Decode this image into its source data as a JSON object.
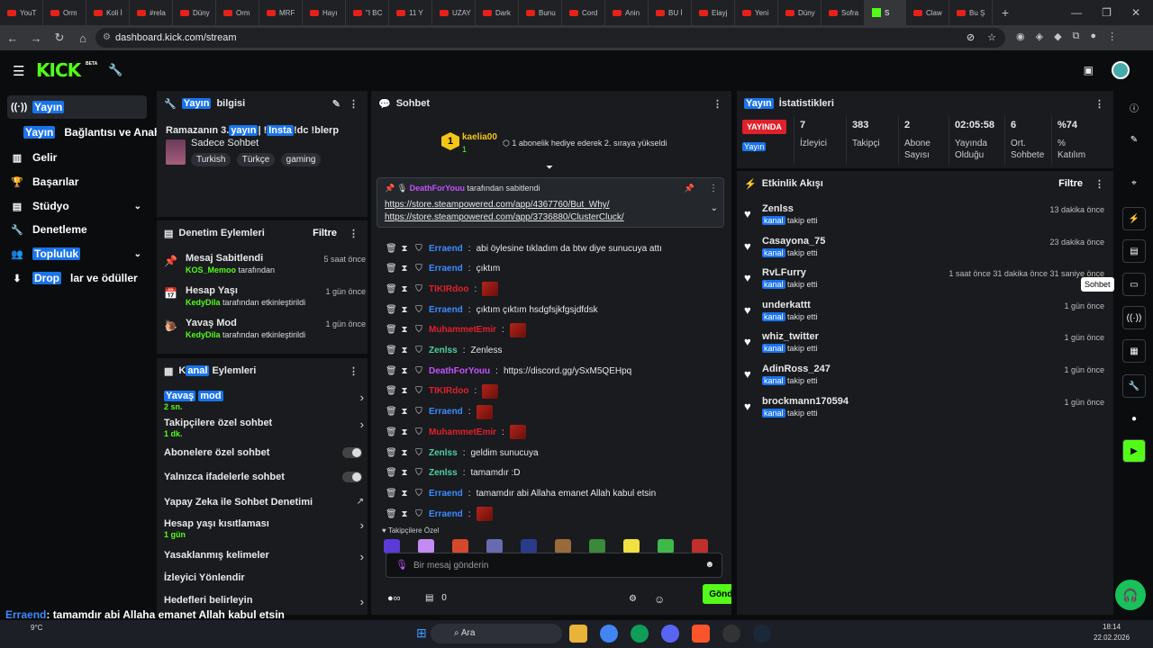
{
  "browser": {
    "tabs": [
      "YouT",
      "Orm",
      "Koli İ",
      "#rela",
      "Düny",
      "Orm",
      "MRF",
      "Hayı",
      "\"I BC",
      "11 Y",
      "UZAY",
      "Dark",
      "Bunu",
      "Cord",
      "Anin",
      "BU İ",
      "Elayj",
      "Yeni",
      "Düny",
      "Sofra",
      "Claw",
      "Bu Ş"
    ],
    "active_tab": "S",
    "url": "dashboard.kick.com/stream"
  },
  "header": {
    "logo": "KICK",
    "beta": "BETA"
  },
  "nav": {
    "items": [
      {
        "label": "Yayın",
        "icon": "broadcast-icon"
      },
      {
        "label": "Yayın",
        "rest": "Bağlantısı ve Anahtarı"
      },
      {
        "label": "Gelir"
      },
      {
        "label": "Başarılar"
      },
      {
        "label": "Stüdyo"
      },
      {
        "label": "Denetleme"
      },
      {
        "label": "Topluluk"
      },
      {
        "label": "Drop",
        "rest": "lar ve ödüller"
      }
    ]
  },
  "info": {
    "head_hl": "Yayın",
    "head_rest": "bilgisi",
    "title_pre": "Ramazanın 3.",
    "title_hl": "yayın",
    "title_mid": "| !",
    "title_hl2": "Insta",
    "title_post": "!dc !blerp",
    "category": "Sadece Sohbet",
    "tags": [
      "Turkish",
      "Türkçe",
      "gaming"
    ]
  },
  "mod": {
    "title": "Denetim Eylemleri",
    "filter": "Filtre",
    "items": [
      {
        "title": "Mesaj Sabitlendi",
        "user": "KOS_Memoo",
        "suffix": "tarafından",
        "time": "5 saat önce"
      },
      {
        "title": "Hesap Yaşı",
        "user": "KedyDila",
        "suffix": "tarafından etkinleştirildi",
        "time": "1 gün önce"
      },
      {
        "title": "Yavaş Mod",
        "user": "KedyDila",
        "suffix": "tarafından etkinleştirildi",
        "time": "1 gün önce"
      }
    ]
  },
  "channel": {
    "title_pre": "K",
    "title_hl": "anal",
    "title_post": "Eylemleri",
    "items": [
      {
        "title": "Yavaş mod",
        "sub": "2 sn."
      },
      {
        "title": "Takipçilere özel sohbet",
        "sub": "1 dk."
      },
      {
        "title": "Abonelere özel sohbet",
        "sub": ""
      },
      {
        "title": "Yalnızca ifadelerle sohbet",
        "sub": ""
      },
      {
        "title": "Yapay Zeka ile Sohbet Denetimi",
        "sub": ""
      },
      {
        "title": "Hesap yaşı kısıtlaması",
        "sub": "1 gün"
      },
      {
        "title": "Yasaklanmış kelimeler",
        "sub": ""
      },
      {
        "title": "İzleyici Yönlendir",
        "sub": ""
      },
      {
        "title": "Hedefleri belirleyin",
        "sub": ""
      }
    ]
  },
  "chat": {
    "title": "Sohbet",
    "sub_user": "kaelia00",
    "sub_count": "1",
    "sub_text": "1 abonelik hediye ederek 2. sıraya yükseldi",
    "pinned_by": "DeathForYouu",
    "pinned_suffix": "tarafından sabitlendi",
    "pinned_links": [
      "https://store.steampowered.com/app/4367760/But_Why/",
      "https://store.steampowered.com/app/3736880/ClusterCluck/"
    ],
    "messages": [
      {
        "user": "Erraend",
        "text": "abi öylesine tıkladım da btw diye sunucuya attı",
        "color": "blue"
      },
      {
        "user": "Erraend",
        "text": "çıktım",
        "color": "blue"
      },
      {
        "user": "TIKIRdoo",
        "text": "",
        "color": "red",
        "emote": true
      },
      {
        "user": "Erraend",
        "text": "çıktım çıktım hsdgfsjkfgsjdfdsk",
        "color": "blue"
      },
      {
        "user": "MuhammetEmir",
        "text": "",
        "color": "red",
        "emote": true
      },
      {
        "user": "Zenlss",
        "text": "Zenless",
        "color": "green"
      },
      {
        "user": "DeathForYouu",
        "text": "https://discord.gg/ySxM5QEHpq",
        "color": "purple"
      },
      {
        "user": "TIKIRdoo",
        "text": "",
        "color": "red",
        "emote": true
      },
      {
        "user": "Erraend",
        "text": "",
        "color": "blue",
        "emote": true
      },
      {
        "user": "MuhammetEmir",
        "text": "",
        "color": "red",
        "emote": true
      },
      {
        "user": "Zenlss",
        "text": "geldim sunucuya",
        "color": "green"
      },
      {
        "user": "Zenlss",
        "text": "tamamdır :D",
        "color": "green"
      },
      {
        "user": "Erraend",
        "text": "tamamdır abi Allaha emanet Allah kabul etsin",
        "color": "blue"
      },
      {
        "user": "Erraend",
        "text": "",
        "color": "blue",
        "emote": true
      }
    ],
    "emote_section": "Takipçilere Özel",
    "placeholder": "Bir mesaj gönderin",
    "count": "0",
    "send": "Gönder"
  },
  "stats": {
    "head_hl": "Yayın",
    "head_rest": "İstatistikleri",
    "live": "YAYINDA",
    "live_sub": "Yayın",
    "items": [
      {
        "value": "7",
        "label": "İzleyici"
      },
      {
        "value": "383",
        "label": "Takipçi"
      },
      {
        "value": "2",
        "label": "Abone Sayısı"
      },
      {
        "value": "02:05:58",
        "label": "Yayında Olduğu"
      },
      {
        "value": "6",
        "label": "Ort. Sohbete"
      },
      {
        "value": "%74",
        "label": "% Katılım"
      }
    ]
  },
  "activity": {
    "title": "Etkinlik Akışı",
    "filter": "Filtre",
    "items": [
      {
        "user": "Zenlss",
        "text": "takip etti",
        "time": "13 dakika önce"
      },
      {
        "user": "Casayona_75",
        "text": "takip etti",
        "time": "23 dakika önce"
      },
      {
        "user": "RvLFurry",
        "text": "takip etti",
        "time": "1 saat önce 31 dakika önce 31 saniye önce"
      },
      {
        "user": "underkattt",
        "text": "takip etti",
        "time": "1 gün önce"
      },
      {
        "user": "whiz_twitter",
        "text": "takip etti",
        "time": "1 gün önce"
      },
      {
        "user": "AdinRoss_247",
        "text": "takip etti",
        "time": "1 gün önce"
      },
      {
        "user": "brockmann170594",
        "text": "takip etti",
        "time": "1 gün önce"
      }
    ],
    "kanal": "kanal"
  },
  "rail": {
    "tooltip": "Sohbet"
  },
  "ticker": {
    "user": "Erraend",
    "text": ": tamamdır abi Allaha emanet Allah kabul etsin"
  },
  "taskbar": {
    "weather": "9°C",
    "search": "Ara",
    "time": "18:14",
    "date": "22.02.2026"
  },
  "colors": {
    "accent": "#53fc18",
    "highlight": "#1a73e8",
    "panel": "#191b1f"
  }
}
